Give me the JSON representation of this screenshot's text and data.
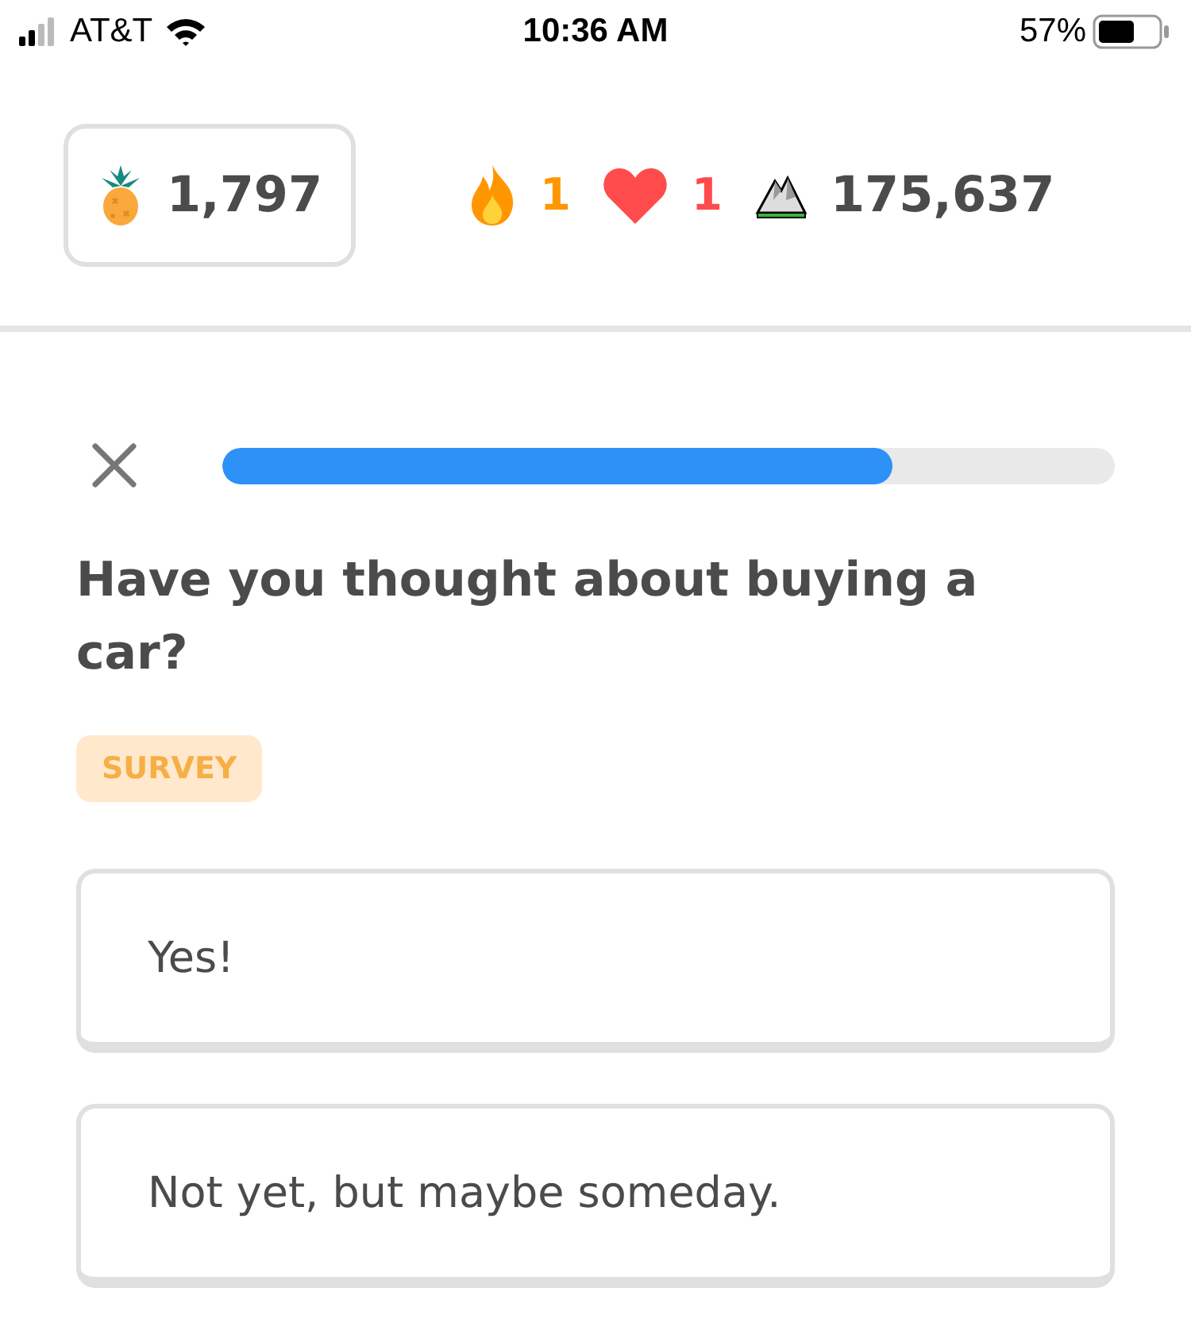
{
  "status_bar": {
    "carrier": "AT&T",
    "time": "10:36 AM",
    "battery": "57%"
  },
  "stats": [
    {
      "kind": "gems",
      "value": "1,797",
      "selected": true
    },
    {
      "kind": "streak",
      "value": "1",
      "selected": false
    },
    {
      "kind": "hearts",
      "value": "1",
      "selected": false
    },
    {
      "kind": "xp",
      "value": "175,637",
      "selected": false
    }
  ],
  "progress": {
    "level": 0.75
  },
  "question": "Have you thought about buying a car?",
  "badge": "SURVEY",
  "options": [
    {
      "label": "Yes!",
      "selected": false
    },
    {
      "label": "Not yet, but maybe someday.",
      "selected": false
    }
  ]
}
